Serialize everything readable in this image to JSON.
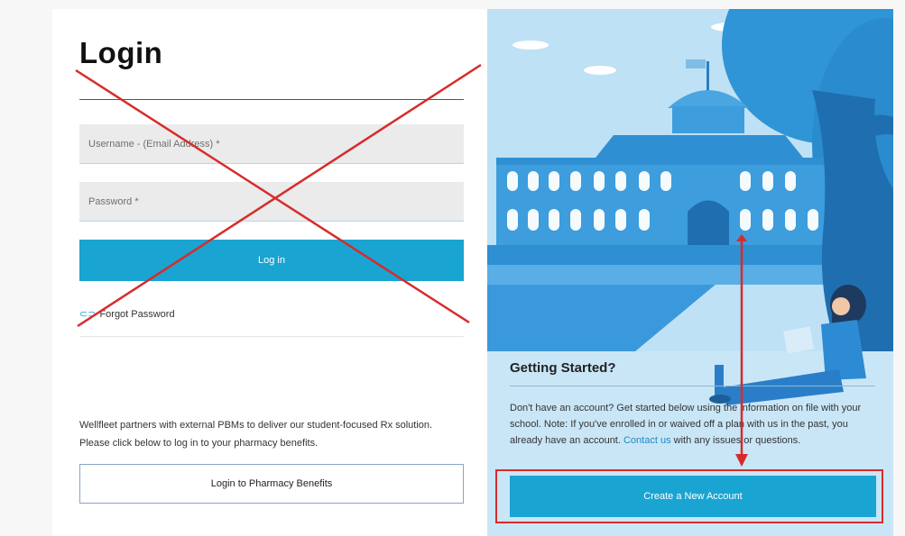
{
  "login": {
    "title": "Login",
    "username_placeholder": "Username - (Email Address) *",
    "password_placeholder": "Password *",
    "login_button": "Log in",
    "forgot_password": "Forgot Password",
    "pbm_text": "Wellfleet partners with external PBMs to deliver our student-focused Rx solution. Please click below to log in to your pharmacy benefits.",
    "pbm_button": "Login to Pharmacy Benefits"
  },
  "getting_started": {
    "title": "Getting Started?",
    "text_before_link": "Don't have an account? Get started below using the information on file with your school. Note: If you've enrolled in or waived off a plan with us in the past, you already have an account. ",
    "contact_link": "Contact us",
    "text_after_link": " with any issues or questions.",
    "create_button": "Create a New Account"
  },
  "colors": {
    "accent": "#1aa4d2",
    "annotation_red": "#d72b2b",
    "illustration_bg": "#bfe1f5"
  },
  "icons": {
    "forgot": "link-icon"
  }
}
